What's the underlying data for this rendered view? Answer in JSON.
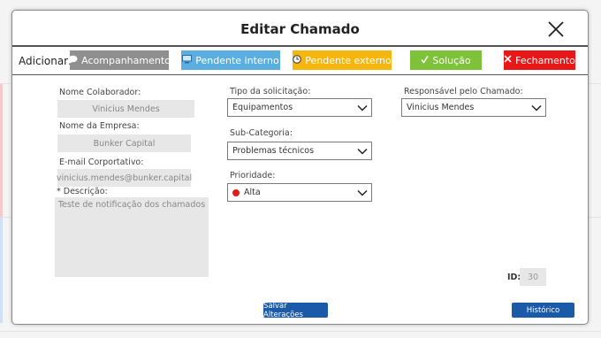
{
  "modal": {
    "title": "Editar Chamado"
  },
  "add_bar": {
    "label": "Adicionar:",
    "buttons": [
      {
        "label": "Acompanhamento",
        "icon": "chat-bubble-icon",
        "color": "#8f8f8f"
      },
      {
        "label": "Pendente interno",
        "icon": "monitor-icon",
        "color": "#5aafe0"
      },
      {
        "label": "Pendente externo",
        "icon": "clock-icon",
        "color": "#f5b60f"
      },
      {
        "label": "Solução",
        "icon": "check-icon",
        "color": "#7ec23a"
      },
      {
        "label": "Fechamento",
        "icon": "x-icon",
        "color": "#e81818"
      }
    ]
  },
  "form": {
    "collaborator_label": "Nome Colaborador:",
    "collaborator_value": "Vinicius Mendes",
    "company_label": "Nome da Empresa:",
    "company_value": "Bunker Capital",
    "email_label": "E-mail Corportativo:",
    "email_value": "vinicius.mendes@bunker.capital",
    "description_label": "* Descrição:",
    "description_value": "Teste de notificação dos chamados",
    "request_type_label": "Tipo da solicitação:",
    "request_type_value": "Equipamentos",
    "subcategory_label": "Sub-Categoria:",
    "subcategory_value": "Problemas técnicos",
    "priority_label": "Prioridade:",
    "priority_value": "Alta",
    "priority_color": "#e51b1b",
    "responsible_label": "Responsável pelo Chamado:",
    "responsible_value": "Vinicius Mendes",
    "id_label": "ID:",
    "id_value": "30"
  },
  "footer": {
    "save_label": "Salvar Alterações",
    "history_label": "Histórico"
  }
}
